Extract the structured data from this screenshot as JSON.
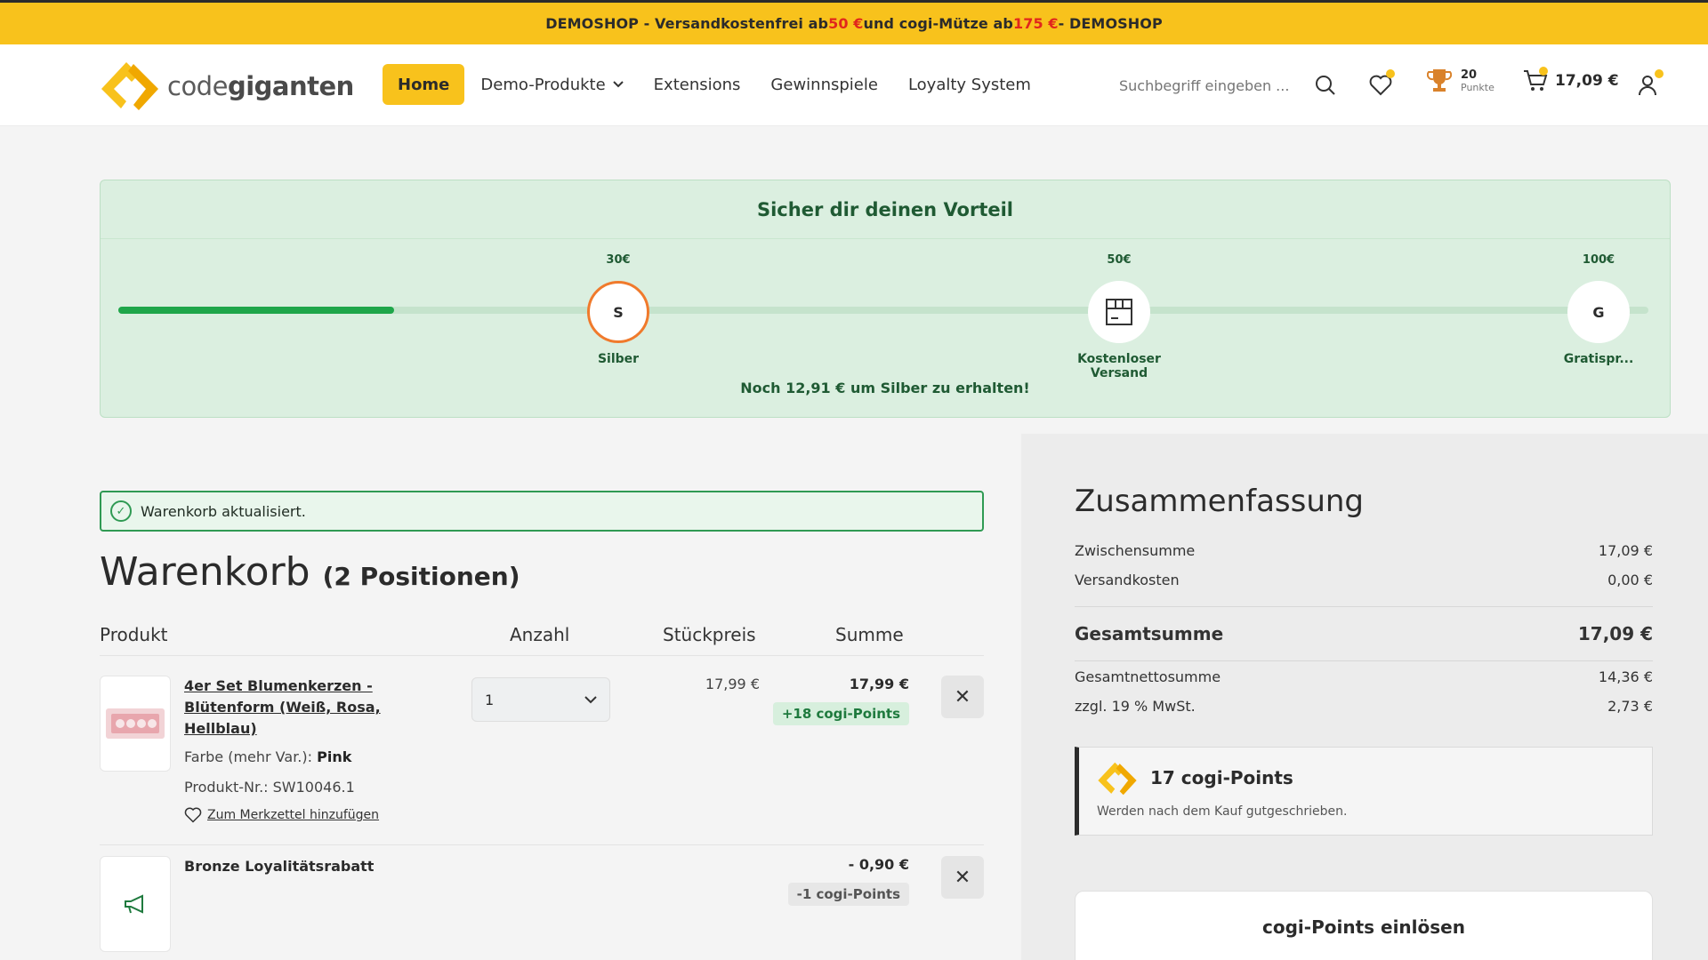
{
  "banner": {
    "part1": "DEMOSHOP - Versandkostenfrei ab ",
    "amount1": "50 €",
    "part2": " und cogi-Mütze ab ",
    "amount2": "175 €",
    "part3": " - DEMOSHOP"
  },
  "header": {
    "logo_prefix": "code",
    "logo_bold": "giganten",
    "nav": [
      "Home",
      "Demo-Produkte",
      "Extensions",
      "Gewinnspiele",
      "Loyalty System"
    ],
    "search_placeholder": "Suchbegriff eingeben ...",
    "points_value": "20",
    "points_label": "Punkte",
    "cart_total": "17,09 €"
  },
  "promo": {
    "title": "Sicher dir deinen Vorteil",
    "progress_fraction": 0.18,
    "stops": [
      {
        "amount": "30€",
        "icon": "S",
        "label": "Silber"
      },
      {
        "amount": "50€",
        "icon": "box-icon",
        "label": "Kostenloser Versand"
      },
      {
        "amount": "100€",
        "icon": "G",
        "label": "Gratispr..."
      }
    ],
    "note": "Noch 12,91 € um Silber zu erhalten!"
  },
  "alert": "Warenkorb aktualisiert.",
  "cart": {
    "title": "Warenkorb",
    "count": "(2 Positionen)",
    "headers": {
      "product": "Produkt",
      "qty": "Anzahl",
      "unit": "Stückpreis",
      "sum": "Summe"
    },
    "items": [
      {
        "name": "4er Set Blumenkerzen - Blütenform (Weiß, Rosa, Hellblau)",
        "variant_label": "Farbe (mehr Var.): ",
        "variant_value": "Pink",
        "sku": "Produkt-Nr.: SW10046.1",
        "wishlist": "Zum Merkzettel hinzufügen",
        "qty": "1",
        "unit_price": "17,99 €",
        "sum": "17,99 €",
        "points": "+18 cogi-Points"
      },
      {
        "name": "Bronze Loyalitätsrabatt",
        "sum": "- 0,90 €",
        "points": "-1 cogi-Points"
      }
    ]
  },
  "summary": {
    "title": "Zusammenfassung",
    "rows": [
      {
        "label": "Zwischensumme",
        "value": "17,09 €"
      },
      {
        "label": "Versandkosten",
        "value": "0,00 €"
      }
    ],
    "total_label": "Gesamtsumme",
    "total_value": "17,09 €",
    "net_rows": [
      {
        "label": "Gesamtnettosumme",
        "value": "14,36 €"
      },
      {
        "label": "zzgl. 19 % MwSt.",
        "value": "2,73 €"
      }
    ],
    "cogi_title": "17 cogi-Points",
    "cogi_sub": "Werden nach dem Kauf gutgeschrieben.",
    "redeem_title": "cogi-Points einlösen"
  },
  "colors": {
    "brand": "#f8c21c",
    "success": "#1fa64a",
    "accent_red": "#e1261c"
  }
}
